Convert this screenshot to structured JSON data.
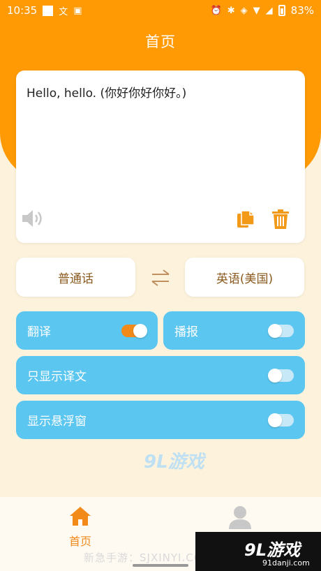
{
  "status_bar": {
    "time": "10:35",
    "battery": "83%",
    "icons": [
      "square-icon",
      "translate-icon",
      "a-icon",
      "alarm-icon",
      "bluetooth-icon",
      "vibrate-icon",
      "wifi-icon",
      "signal-icon",
      "battery-icon"
    ]
  },
  "header": {
    "title": "首页"
  },
  "translation": {
    "text": "Hello, hello. (你好你好你好。)"
  },
  "languages": {
    "source": "普通话",
    "target": "英语(美国)"
  },
  "toggles": {
    "translate": {
      "label": "翻译",
      "on": true
    },
    "broadcast": {
      "label": "播报",
      "on": false
    },
    "only_translation": {
      "label": "只显示译文",
      "on": false
    },
    "floating_window": {
      "label": "显示悬浮窗",
      "on": false
    }
  },
  "bottom_nav": {
    "home_label": "首页"
  },
  "watermarks": {
    "center": "9L游戏",
    "brand": "9L游戏",
    "url": "91danji.com",
    "site": "新急手游：SJXINYI.COM"
  },
  "colors": {
    "accent_orange": "#ff9a05",
    "pill_blue": "#5bc6f0",
    "toggle_on": "#f28a1a",
    "background": "#fdf3dd"
  }
}
